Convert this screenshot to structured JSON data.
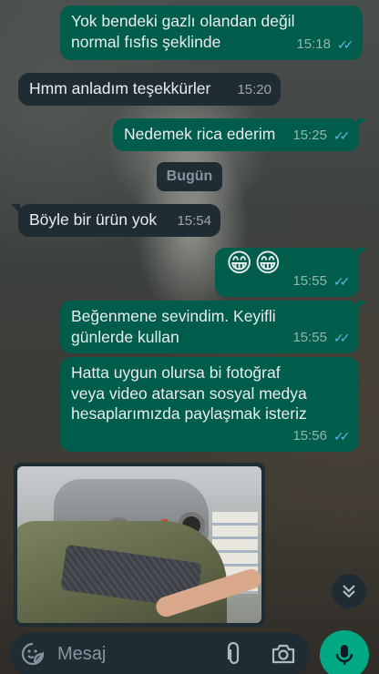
{
  "messages": [
    {
      "direction": "out",
      "lines": [
        "Yok bendeki gazlı olandan değil",
        "normal fısfıs şeklinde"
      ],
      "time": "15:18",
      "read": true
    },
    {
      "direction": "in",
      "lines": [
        "Hmm anladım teşekkürler"
      ],
      "time": "15:20"
    },
    {
      "direction": "out",
      "lines": [
        "Nedemek rica ederim"
      ],
      "time": "15:25",
      "read": true
    },
    {
      "direction": "in",
      "lines": [
        "Böyle bir ürün yok"
      ],
      "time": "15:54"
    },
    {
      "direction": "out",
      "lines": [
        "😁😁"
      ],
      "time": "15:55",
      "read": true
    },
    {
      "direction": "out",
      "lines": [
        "Beğenmene sevindim. Keyifli",
        "günlerde kullan"
      ],
      "time": "15:55",
      "read": true
    },
    {
      "direction": "out",
      "lines": [
        "Hatta uygun olursa bi fotoğraf",
        "veya video atarsan sosyal medya",
        "hesaplarımızda paylaşmak isteriz"
      ],
      "time": "15:56",
      "read": true
    }
  ],
  "date_separator": "Bugün",
  "photo_message": {
    "icon": "image-thumbnail"
  },
  "input": {
    "placeholder": "Mesaj",
    "value": ""
  },
  "icons": {
    "emoji": "sticker-icon",
    "attach": "paperclip-icon",
    "camera": "camera-icon",
    "mic": "microphone-icon",
    "scroll": "double-chevron-down-icon"
  },
  "colors": {
    "outgoing_bubble": "#005c4b",
    "incoming_bubble": "#202c33",
    "read_ticks": "#53bdeb",
    "accent": "#00a884"
  }
}
